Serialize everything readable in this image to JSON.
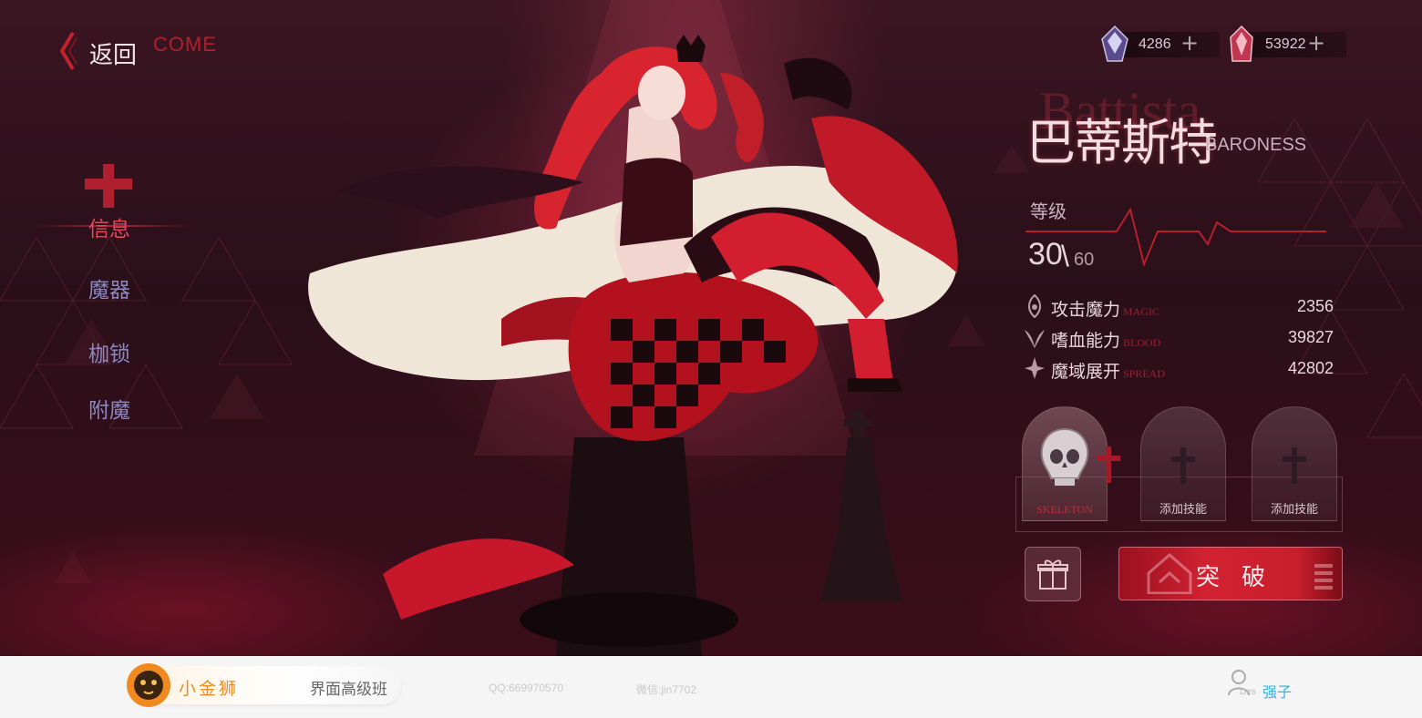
{
  "nav": {
    "back_label": "返回",
    "back_ghost": "COME"
  },
  "menu": {
    "items": [
      "信息",
      "魔器",
      "枷锁",
      "附魔"
    ],
    "active_index": 0
  },
  "currencies": [
    {
      "icon": "purple-crystal-icon",
      "value": "4286"
    },
    {
      "icon": "red-crystal-icon",
      "value": "53922"
    }
  ],
  "plus_label": "+",
  "character": {
    "name_bg": "Battista",
    "name_cn": "巴蒂斯特",
    "name_en": "BARONESS",
    "level_label": "等级",
    "level_current": "30",
    "level_separator": "\\",
    "level_max": "60",
    "stats": [
      {
        "icon": "magic-icon",
        "name": "攻击魔力",
        "en": "MAGIC",
        "value": "2356"
      },
      {
        "icon": "blood-icon",
        "name": "嗜血能力",
        "en": "BLOOD",
        "value": "39827"
      },
      {
        "icon": "spread-icon",
        "name": "魔域展开",
        "en": "SPREAD",
        "value": "42802"
      }
    ]
  },
  "skills": [
    {
      "label": "SKELETON",
      "icon": "skull-icon"
    },
    {
      "label": "添加技能",
      "icon": "cross-icon"
    },
    {
      "label": "添加技能",
      "icon": "cross-icon"
    }
  ],
  "actions": {
    "gift_icon": "gift-icon",
    "breakthrough_label": "突破"
  },
  "colors": {
    "accent": "#d22232",
    "menu": "#8b88c4",
    "menu_active": "#e3485a"
  },
  "footer": {
    "brand_name": "小金狮",
    "course": "界面高级班",
    "qq": "QQ:669970570",
    "wechat": "微信:jin7702",
    "user_des": "Des",
    "user_name": "强子"
  }
}
